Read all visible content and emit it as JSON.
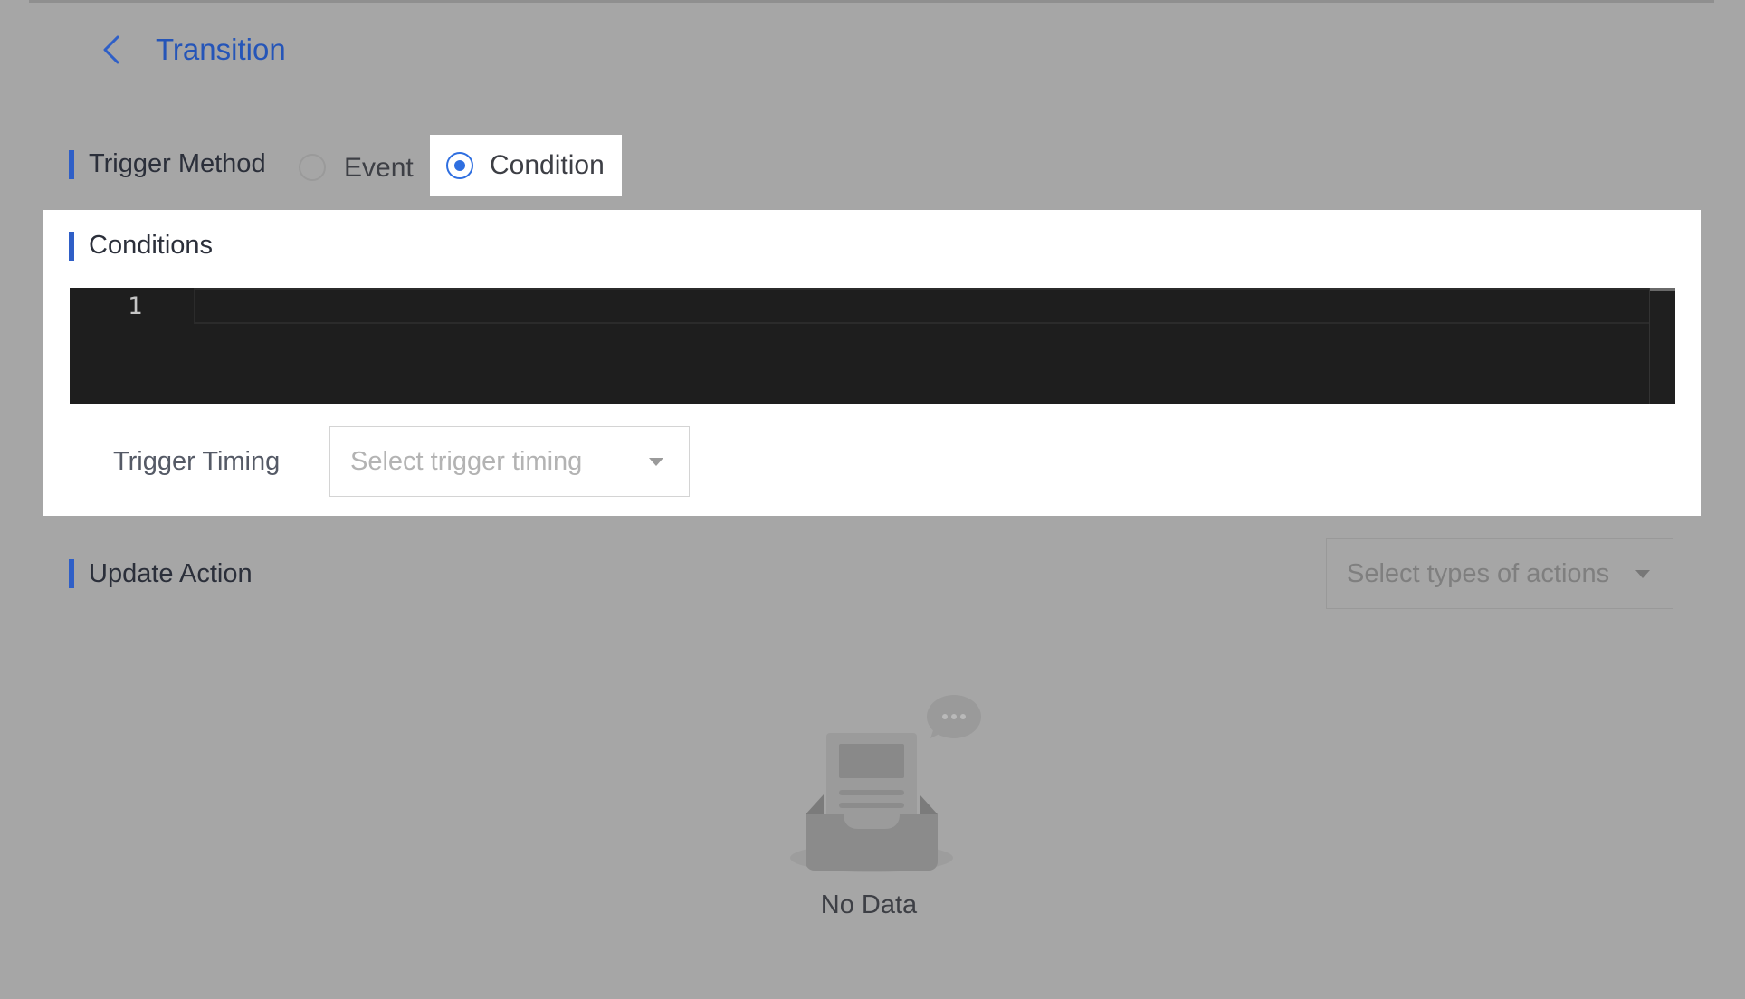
{
  "header": {
    "title": "Transition",
    "back_icon": "chevron-left-icon"
  },
  "trigger_method": {
    "label": "Trigger Method",
    "options": [
      {
        "label": "Event",
        "selected": false
      },
      {
        "label": "Condition",
        "selected": true
      }
    ]
  },
  "conditions": {
    "label": "Conditions",
    "editor": {
      "line_numbers": [
        "1"
      ],
      "content": ""
    },
    "trigger_timing": {
      "label": "Trigger Timing",
      "placeholder": "Select trigger timing"
    }
  },
  "update_action": {
    "label": "Update Action",
    "select_placeholder": "Select types of actions",
    "empty_text": "No Data"
  },
  "colors": {
    "accent": "#2f6fe0",
    "section_bar": "#2f5fc7",
    "title": "#2555b8",
    "overlay_background": "#a6a6a6",
    "editor_background": "#1e1e1e"
  }
}
